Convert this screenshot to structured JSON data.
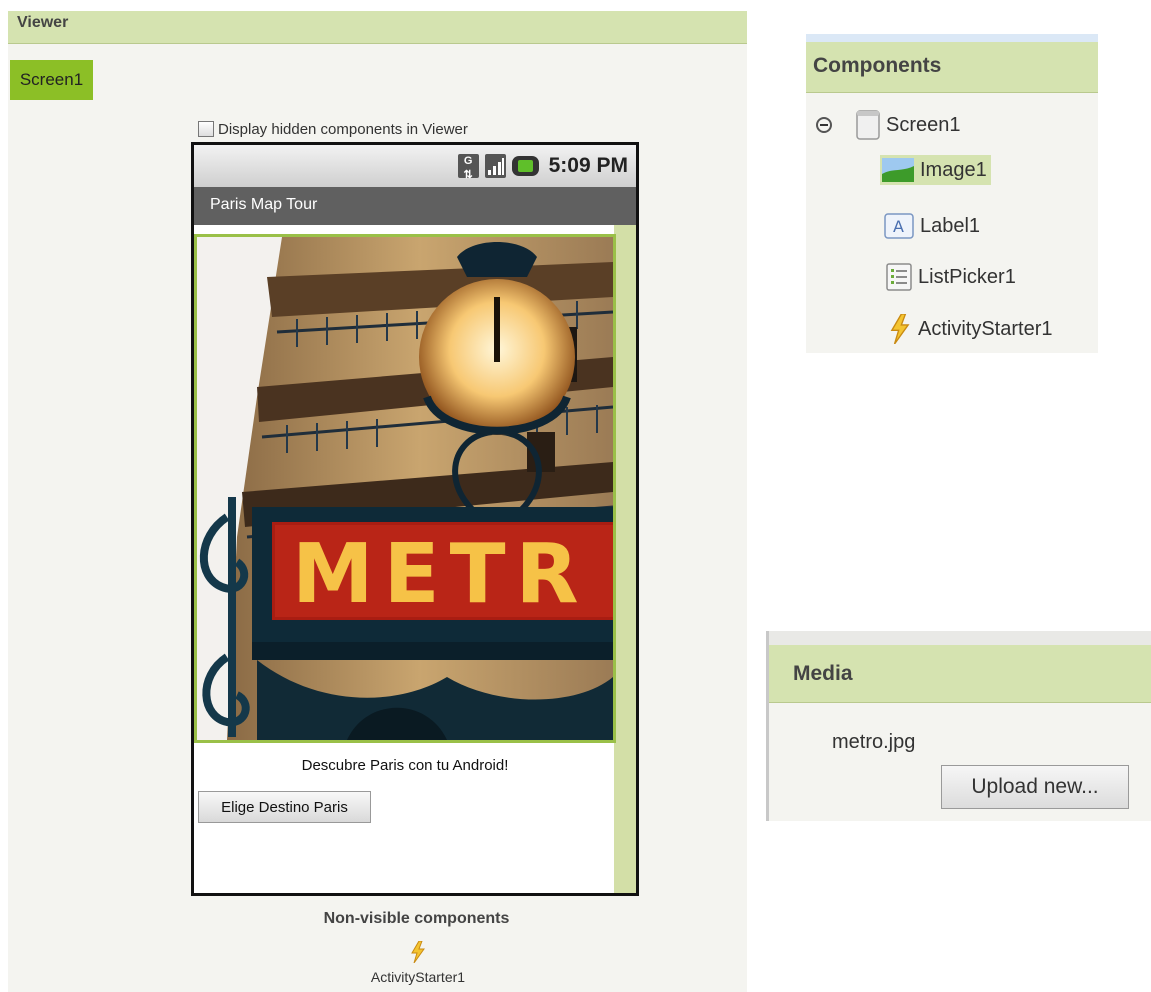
{
  "viewer": {
    "header": "Viewer",
    "screen_tab": "Screen1",
    "hidden_toggle_label": "Display hidden components in Viewer",
    "hidden_toggle_checked": false,
    "phone": {
      "status_time": "5:09 PM",
      "app_title": "Paris Map Tour",
      "label_text": "Descubre Paris con tu Android!",
      "button_text": "Elige Destino Paris",
      "image_sign_text": "METR"
    },
    "nonvisible_title": "Non-visible components",
    "nonvisible_items": [
      "ActivityStarter1"
    ]
  },
  "components": {
    "header": "Components",
    "tree": [
      {
        "label": "Screen1",
        "icon": "screen-icon"
      },
      {
        "label": "Image1",
        "icon": "image-icon",
        "selected": true
      },
      {
        "label": "Label1",
        "icon": "label-icon"
      },
      {
        "label": "ListPicker1",
        "icon": "listpicker-icon"
      },
      {
        "label": "ActivityStarter1",
        "icon": "lightning-icon"
      }
    ]
  },
  "media": {
    "header": "Media",
    "files": [
      "metro.jpg"
    ],
    "upload_label": "Upload new..."
  },
  "colors": {
    "panel_header": "#d5e3b0",
    "accent_green": "#8cbf26",
    "phone_title_bar": "#606060"
  }
}
